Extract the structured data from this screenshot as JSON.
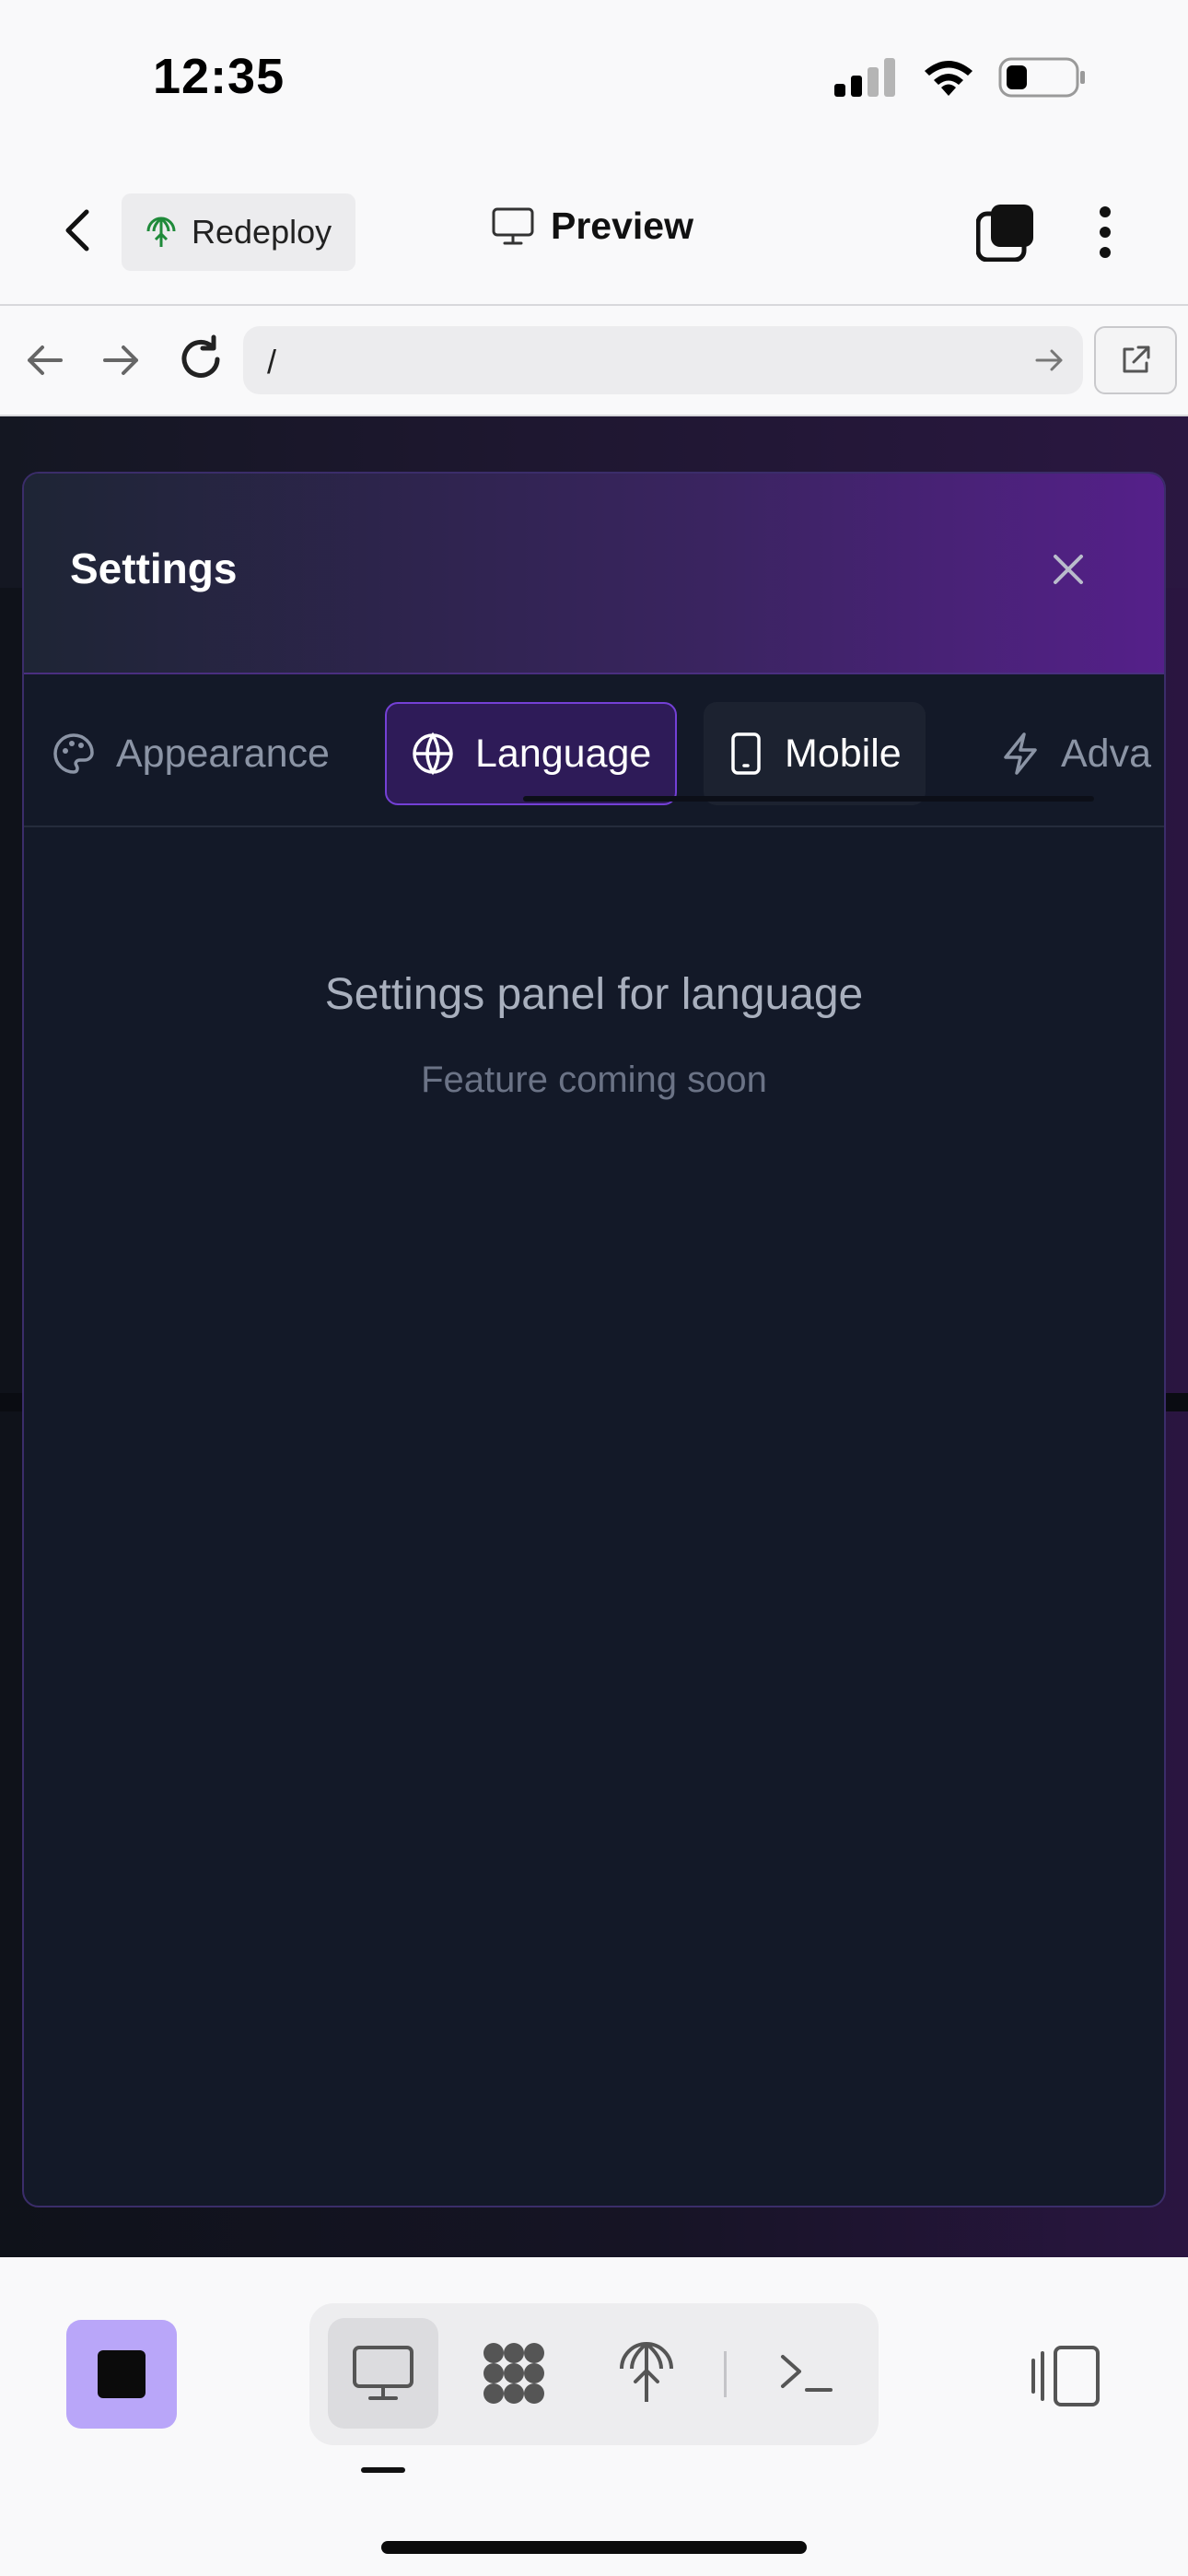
{
  "status_bar": {
    "time": "12:35",
    "icons": [
      "signal-icon",
      "wifi-icon",
      "battery-icon"
    ]
  },
  "header": {
    "back_icon": "chevron-left-icon",
    "redeploy_label": "Redeploy",
    "redeploy_icon": "deploy-globe-icon",
    "title": "Preview",
    "title_icon": "monitor-icon",
    "tabs_icon": "tabs-icon",
    "more_icon": "more-vertical-icon"
  },
  "browser": {
    "url": "/",
    "icons": [
      "arrow-left-icon",
      "arrow-right-icon",
      "reload-icon",
      "go-arrow-icon",
      "open-external-icon"
    ]
  },
  "modal": {
    "title": "Settings",
    "close_icon": "close-icon",
    "tabs": [
      {
        "label": "Appearance",
        "icon": "palette-icon",
        "active": false
      },
      {
        "label": "Language",
        "icon": "globe-icon",
        "active": true
      },
      {
        "label": "Mobile",
        "icon": "smartphone-icon",
        "active": false
      },
      {
        "label": "Adva",
        "icon": "zap-icon",
        "active": false
      }
    ],
    "panel_title": "Settings panel for language",
    "panel_subtitle": "Feature coming soon"
  },
  "toolbar": {
    "stop_icon": "stop-icon",
    "views": [
      "desktop-view-icon",
      "api-icon",
      "deploy-icon",
      "terminal-icon"
    ],
    "active_view": "desktop-view-icon",
    "split_icon": "split-view-icon"
  },
  "colors": {
    "accent": "#b9a6f9",
    "modal_bg": "#131928",
    "active_tab_bg": "#2e1b58",
    "active_tab_border": "#7440d6",
    "header_gradient_end": "#55208a"
  }
}
